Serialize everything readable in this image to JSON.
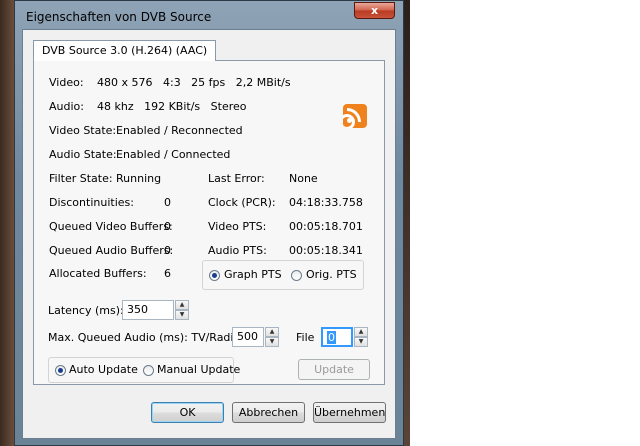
{
  "window": {
    "title": "Eigenschaften von DVB Source",
    "close_glyph": "x"
  },
  "tab": {
    "label": "DVB Source 3.0 (H.264) (AAC)"
  },
  "video": {
    "label": "Video:",
    "value": "480 x 576   4:3   25 fps   2,2 MBit/s"
  },
  "audio": {
    "label": "Audio:",
    "value": "48 khz   192 KBit/s   Stereo"
  },
  "video_state": {
    "label": "Video State:",
    "value": "Enabled / Reconnected"
  },
  "audio_state": {
    "label": "Audio State:",
    "value": "Enabled / Connected"
  },
  "filter_state": {
    "label": "Filter State:",
    "value": "Running"
  },
  "last_error": {
    "label": "Last Error:",
    "value": "None"
  },
  "discontinuities": {
    "label": "Discontinuities:",
    "value": "0"
  },
  "clock": {
    "label": "Clock (PCR):",
    "value": "04:18:33.758"
  },
  "queued_video": {
    "label": "Queued Video Buffers:",
    "value": "0"
  },
  "video_pts": {
    "label": "Video PTS:",
    "value": "00:05:18.701"
  },
  "queued_audio": {
    "label": "Queued Audio Buffers:",
    "value": "0"
  },
  "audio_pts": {
    "label": "Audio PTS:",
    "value": "00:05:18.341"
  },
  "allocated": {
    "label": "Allocated Buffers:",
    "value": "6"
  },
  "pts_mode": {
    "graph": "Graph PTS",
    "orig": "Orig. PTS",
    "selected": "Graph PTS"
  },
  "latency": {
    "label": "Latency (ms):",
    "value": "350"
  },
  "max_queued": {
    "label": "Max. Queued Audio (ms): TV/Radio",
    "value": "500"
  },
  "file": {
    "label": "File",
    "value": "0"
  },
  "update_mode": {
    "auto": "Auto Update",
    "manual": "Manual Update",
    "selected": "Auto Update"
  },
  "buttons": {
    "update": "Update",
    "ok": "OK",
    "cancel": "Abbrechen",
    "apply": "Übernehmen"
  },
  "colors": {
    "rss": "#f0821e",
    "title_bar": "#8fa3b6",
    "selection": "#3399ff"
  },
  "icons": {
    "logo": "rss-feed-icon",
    "spin_up": "spin-up-arrow-icon",
    "spin_down": "spin-down-arrow-icon"
  }
}
